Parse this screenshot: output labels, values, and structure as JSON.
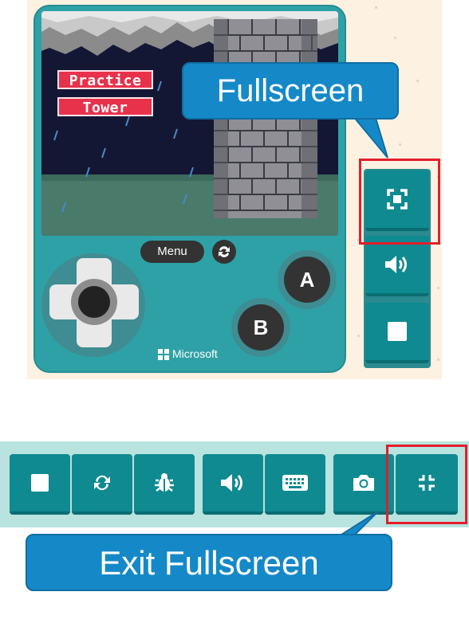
{
  "game": {
    "title_line1": "Practice",
    "title_line2": "Tower",
    "menu_label": "Menu",
    "button_a": "A",
    "button_b": "B",
    "brand": "Microsoft"
  },
  "callouts": {
    "fullscreen": "Fullscreen",
    "exit_fullscreen": "Exit Fullscreen"
  },
  "sidebar_buttons": [
    "fullscreen-icon",
    "volume-icon",
    "stop-icon"
  ],
  "toolbar_buttons": [
    "stop-icon",
    "restart-icon",
    "debug-icon",
    "volume-icon",
    "keyboard-icon",
    "screenshot-icon",
    "exit-fullscreen-icon"
  ],
  "colors": {
    "device": "#2ea1a6",
    "button_teal": "#0e8a90",
    "highlight_red": "#e41d2a",
    "callout_blue": "#1589c7",
    "title_tag_red": "#e8324b"
  }
}
